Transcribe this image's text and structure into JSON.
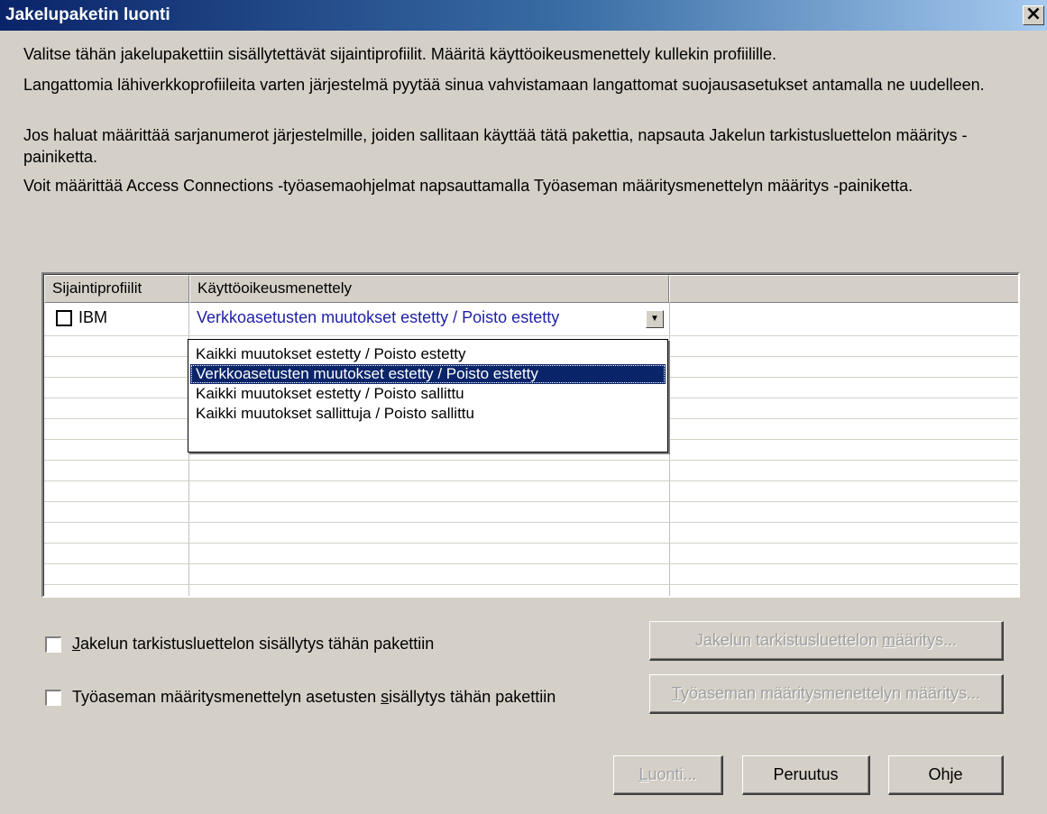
{
  "window": {
    "title": "Jakelupaketin luonti",
    "close_glyph": "×"
  },
  "instructions": [
    "Valitse tähän jakelupakettiin sisällytettävät sijaintiprofiilit. Määritä käyttöoikeusmenettely kullekin profiilille.",
    "Langattomia lähiverkkoprofiileita varten järjestelmä pyytää sinua vahvistamaan langattomat suojausasetukset antamalla ne uudelleen.",
    "Jos haluat määrittää sarjanumerot järjestelmille, joiden sallitaan käyttää tätä pakettia, napsauta Jakelun tarkistusluettelon määritys -painiketta.",
    "Voit määrittää Access Connections -työasemaohjelmat napsauttamalla Työaseman määritysmenettelyn määritys -painiketta."
  ],
  "grid": {
    "columns": [
      "Sijaintiprofiilit",
      "Käyttöoikeusmenettely"
    ],
    "rows": [
      {
        "profile": "IBM",
        "checked": false,
        "policy": "Verkkoasetusten muutokset estetty / Poisto estetty"
      }
    ],
    "combo_arrow_icon": "chevron-down-icon",
    "dropdown_options": [
      "Kaikki muutokset estetty / Poisto estetty",
      "Verkkoasetusten muutokset estetty / Poisto estetty",
      "Kaikki muutokset estetty / Poisto sallittu",
      "Kaikki muutokset sallittuja / Poisto sallittu"
    ],
    "dropdown_selected_index": 1
  },
  "options": {
    "checklist_include": {
      "prefix": "",
      "accel": "J",
      "rest": "akelun tarkistusluettelon sisällytys tähän pakettiin",
      "checked": false
    },
    "workstation_include": {
      "prefix": "Työaseman määritysmenettelyn asetusten ",
      "accel": "s",
      "rest": "isällytys tähän pakettiin",
      "checked": false
    }
  },
  "buttons": {
    "checklist_define": {
      "prefix": "Jakelun tarkistusluettelon ",
      "accel": "m",
      "rest": "ääritys..."
    },
    "workstation_define": {
      "prefix": "",
      "accel": "T",
      "rest": "yöaseman määritysmenettelyn määritys..."
    },
    "create": {
      "prefix": "",
      "accel": "L",
      "rest": "uonti..."
    },
    "cancel": "Peruutus",
    "help": "Ohje"
  }
}
